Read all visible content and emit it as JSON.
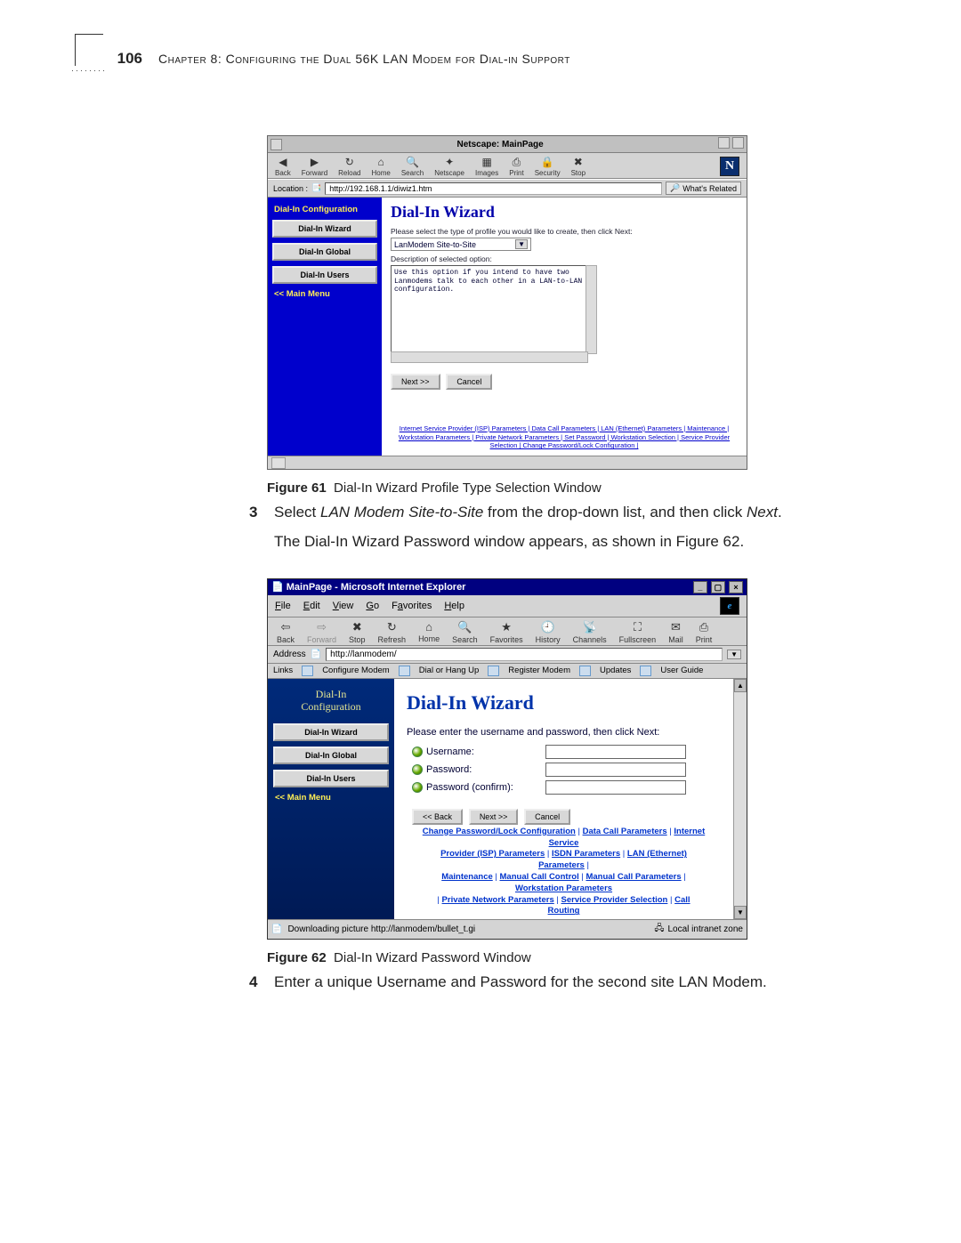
{
  "page": {
    "number": "106",
    "chapter": "Chapter 8: Configuring the Dual 56K LAN Modem for Dial-in Support"
  },
  "netscape": {
    "title": "Netscape: MainPage",
    "toolbar": [
      "Back",
      "Forward",
      "Reload",
      "Home",
      "Search",
      "Netscape",
      "Images",
      "Print",
      "Security",
      "Stop"
    ],
    "location_label": "Location :",
    "location_url": "http://192.168.1.1/diwiz1.htm",
    "whats_related": "What's Related",
    "sidebar": {
      "heading": "Dial-In Configuration",
      "items": [
        "Dial-In Wizard",
        "Dial-In Global",
        "Dial-In Users"
      ],
      "main": "<< Main Menu"
    },
    "wizard": {
      "title": "Dial-In Wizard",
      "prompt": "Please select the type of profile you would like to create, then click Next:",
      "option": "LanModem Site-to-Site",
      "desc_label": "Description of selected option:",
      "desc_text": "Use this option if you intend to have two Lanmodems talk to each other in a LAN-to-LAN configuration.",
      "next": "Next >>",
      "cancel": "Cancel"
    },
    "footer1": "Internet Service Provider (ISP) Parameters | Data Call Parameters | LAN (Ethernet) Parameters | Maintenance |",
    "footer2": "Workstation Parameters | Private Network Parameters | Set Password | Workstation Selection | Service Provider",
    "footer3": "Selection | Change Password/Lock Configuration |"
  },
  "caption1": {
    "label": "Figure 61",
    "text": "Dial-In Wizard Profile Type Selection Window"
  },
  "step3": {
    "num": "3",
    "text_a": "Select ",
    "text_italic": "LAN Modem Site-to-Site",
    "text_b": " from the drop-down list, and then click ",
    "text_italic2": "Next",
    "text_c": "."
  },
  "body62": "The Dial-In Wizard Password window appears, as shown in Figure 62.",
  "ie": {
    "title": "MainPage - Microsoft Internet Explorer",
    "menu": [
      "File",
      "Edit",
      "View",
      "Go",
      "Favorites",
      "Help"
    ],
    "toolbar": [
      "Back",
      "Forward",
      "Stop",
      "Refresh",
      "Home",
      "Search",
      "Favorites",
      "History",
      "Channels",
      "Fullscreen",
      "Mail",
      "Print"
    ],
    "address_label": "Address",
    "address_url": "http://lanmodem/",
    "links_label": "Links",
    "links": [
      "Configure Modem",
      "Dial or Hang Up",
      "Register Modem",
      "Updates",
      "User Guide"
    ],
    "sidebar": {
      "heading1": "Dial-In",
      "heading2": "Configuration",
      "items": [
        "Dial-In Wizard",
        "Dial-In Global",
        "Dial-In Users"
      ],
      "main": "<< Main Menu"
    },
    "wizard": {
      "title": "Dial-In Wizard",
      "prompt": "Please enter the username and password, then click Next:",
      "username": "Username:",
      "password": "Password:",
      "confirm": "Password (confirm):",
      "back": "<< Back",
      "next": "Next >>",
      "cancel": "Cancel"
    },
    "footer": {
      "l1a": "Change Password/Lock Configuration",
      "l1b": "Data Call Parameters",
      "l1c": "Internet Service",
      "l2a": "Provider (ISP) Parameters",
      "l2b": "ISDN Parameters",
      "l2c": "LAN (Ethernet) Parameters",
      "l3a": "Maintenance",
      "l3b": "Manual Call Control",
      "l3c": "Manual Call Parameters",
      "l3d": "Workstation Parameters",
      "l4a": "Private Network Parameters",
      "l4b": "Service Provider Selection",
      "l4c": "Call Routing"
    },
    "status_left": "Downloading picture http://lanmodem/bullet_t.gi",
    "status_zone": "Local intranet zone"
  },
  "caption2": {
    "label": "Figure 62",
    "text": "Dial-In Wizard Password Window"
  },
  "step4": {
    "num": "4",
    "text": "Enter a unique Username and Password for the second site LAN Modem."
  }
}
